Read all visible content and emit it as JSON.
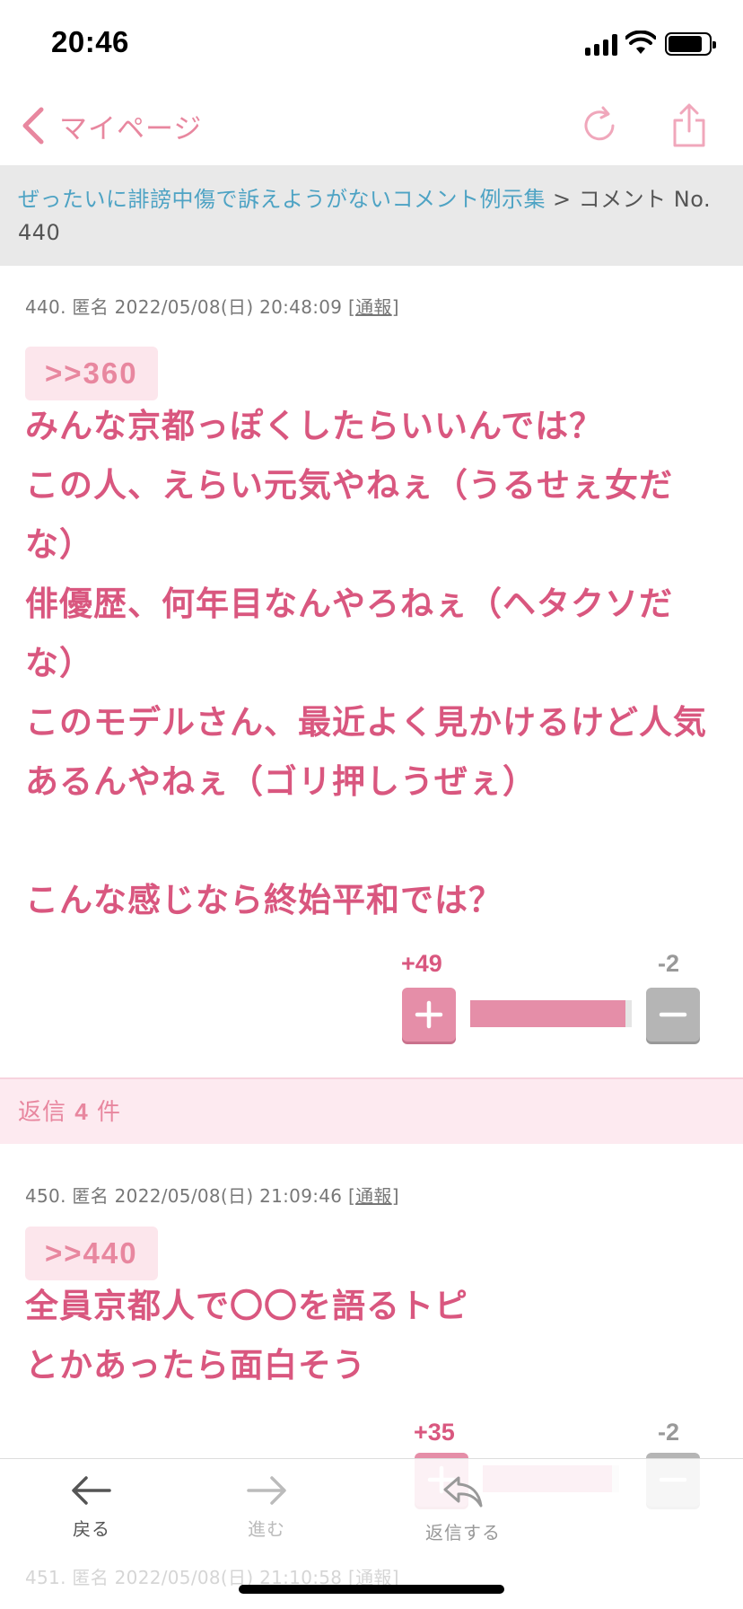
{
  "status_bar": {
    "time": "20:46",
    "battery_level": 0.85
  },
  "nav": {
    "back_label": "マイページ",
    "reload_icon": "reload-icon",
    "share_icon": "share-icon"
  },
  "breadcrumb": {
    "topic": "ぜったいに誹謗中傷で訴えようがないコメント例示集",
    "separator": ">",
    "current": "コメント No. 440"
  },
  "comments": [
    {
      "meta": "440. 匿名 2022/05/08(日) 20:48:09 [",
      "report": "通報",
      "meta_end": "]",
      "anchor": ">>360",
      "body": "みんな京都っぽくしたらいいんでは？\nこの人、えらい元気やねぇ（うるせぇ女だな）\n俳優歴、何年目なんやろねぇ（ヘタクソだな）\nこのモデルさん、最近よく見かけるけど人気あるんやねぇ（ゴリ押しうぜぇ）\n\nこんな感じなら終始平和では？",
      "plus": "+49",
      "minus": "-2",
      "plus_ratio": 0.96
    },
    {
      "meta": "450. 匿名 2022/05/08(日) 21:09:46 [",
      "report": "通報",
      "meta_end": "]",
      "anchor": ">>440",
      "body": "全員京都人で〇〇を語るトピ\nとかあったら面白そう",
      "plus": "+35",
      "minus": "-2",
      "plus_ratio": 0.95
    },
    {
      "meta": "451. 匿名 2022/05/08(日) 21:10:58 [",
      "report": "通報",
      "meta_end": "]"
    }
  ],
  "replies": {
    "prefix": "返信",
    "count": "4",
    "suffix": "件"
  },
  "toolbar": {
    "back_label": "戻る",
    "forward_label": "進む",
    "reply_label": "返信する"
  },
  "colors": {
    "accent": "#d9577f",
    "accent_light": "#e8879f",
    "link": "#4ea3c4"
  }
}
